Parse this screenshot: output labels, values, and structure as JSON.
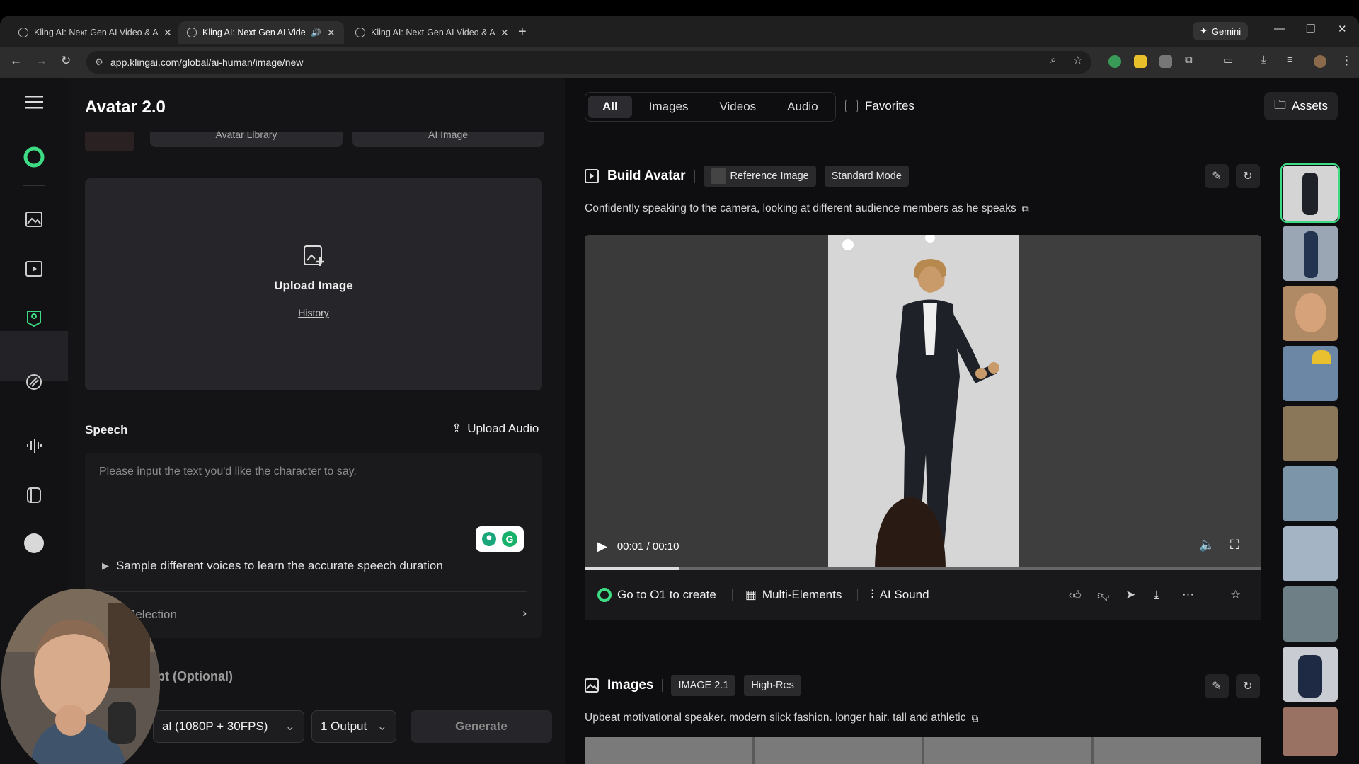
{
  "browser": {
    "tabs": [
      {
        "title": "Kling AI: Next-Gen AI Video & AI Image"
      },
      {
        "title": "Kling AI: Next-Gen AI Video & AI Image"
      },
      {
        "title": "Kling AI: Next-Gen AI Video & AI Image"
      }
    ],
    "gemini_label": "Gemini",
    "url": "app.klingai.com/global/ai-human/image/new"
  },
  "panel": {
    "title": "Avatar 2.0",
    "avatar_library": "Avatar Library",
    "ai_image": "AI Image",
    "upload_image": "Upload Image",
    "history": "History",
    "speech_label": "Speech",
    "upload_audio": "Upload Audio",
    "speech_placeholder": "Please input the text you'd like the character to say.",
    "sample_voices": "Sample different voices to learn the accurate speech duration",
    "selection_label": "Selection",
    "prompt_optional": "pt (Optional)",
    "quality_value": "al (1080P + 30FPS)",
    "output_value": "1 Output",
    "generate_label": "Generate"
  },
  "filters": {
    "tabs": [
      "All",
      "Images",
      "Videos",
      "Audio"
    ],
    "active": "All",
    "favorites_label": "Favorites",
    "assets_label": "Assets"
  },
  "build_avatar": {
    "heading": "Build Avatar",
    "chip_reference": "Reference Image",
    "chip_mode": "Standard Mode",
    "description": "Confidently speaking to the camera, looking at different audience members as he speaks",
    "time": "00:01 / 00:10",
    "progress": 0.14,
    "go_o1": "Go to O1 to create",
    "multi_elements": "Multi-Elements",
    "ai_sound": "AI Sound"
  },
  "images_section": {
    "heading": "Images",
    "chip_model": "IMAGE 2.1",
    "chip_res": "High-Res",
    "description": "Upbeat motivational speaker. modern slick fashion. longer hair. tall and athletic"
  },
  "colors": {
    "accent_green": "#3ddc84",
    "panel_bg": "#141416",
    "app_bg": "#0d0d0f"
  },
  "icons": [
    "menu-icon",
    "kling-logo-icon",
    "image-icon",
    "video-icon",
    "avatar-icon",
    "effects-icon",
    "audio-icon",
    "assets-icon",
    "profile-icon"
  ]
}
